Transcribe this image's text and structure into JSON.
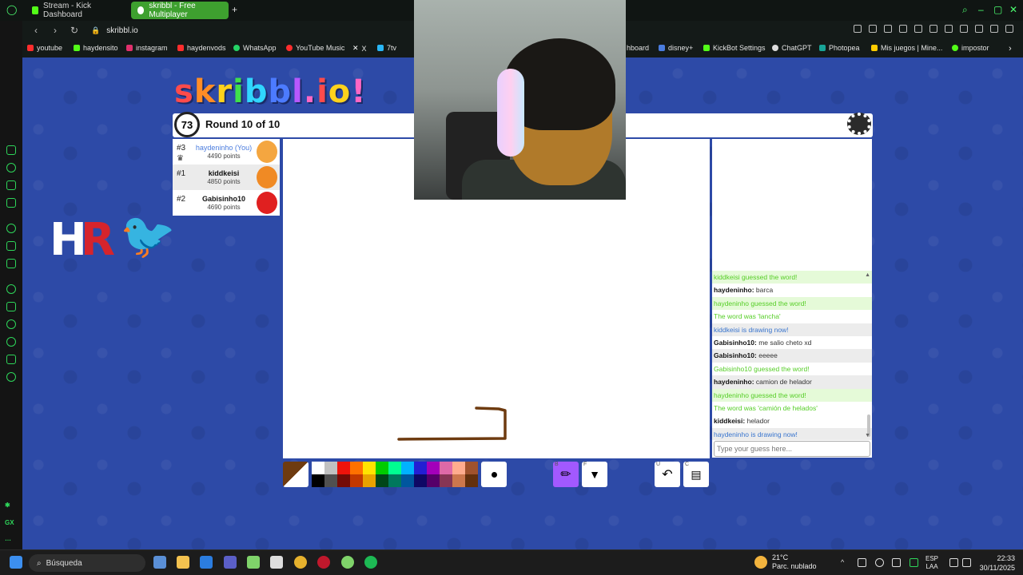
{
  "browser": {
    "tabs": [
      {
        "label": "Stream - Kick Dashboard",
        "color": "#53fc18"
      },
      {
        "label": "skribbl - Free Multiplayer",
        "color": "#ffffff"
      }
    ],
    "new_tab": "+",
    "url": "skribbl.io",
    "bookmarks": [
      {
        "label": "youtube",
        "color": "#ff2d2d"
      },
      {
        "label": "haydensito",
        "color": "#53fc18"
      },
      {
        "label": "instagram",
        "color": "#e1306c"
      },
      {
        "label": "haydenvods",
        "color": "#ff2d2d"
      },
      {
        "label": "WhatsApp",
        "color": "#25d366"
      },
      {
        "label": "YouTube Music",
        "color": "#ff2d2d"
      },
      {
        "label": "X",
        "color": "#ffffff"
      },
      {
        "label": "7tv",
        "color": "#29b6f6"
      },
      {
        "label": "hboard",
        "color": "#888888"
      },
      {
        "label": "disney+",
        "color": "#4a7cde"
      },
      {
        "label": "KickBot Settings",
        "color": "#53fc18"
      },
      {
        "label": "ChatGPT",
        "color": "#dddddd"
      },
      {
        "label": "Photopea",
        "color": "#18a497"
      },
      {
        "label": "Mis juegos | Mine...",
        "color": "#ffcc00"
      },
      {
        "label": "impostor",
        "color": "#53fc18"
      }
    ],
    "sidebar_labels": [
      "GX"
    ]
  },
  "game": {
    "logo": "skribbl.io",
    "timer": "73",
    "round": "Round 10 of 10",
    "players": [
      {
        "rank": "#3",
        "name": "haydeninho (You)",
        "points": "4490 points",
        "avatar_color": "#f4a640"
      },
      {
        "rank": "#1",
        "name": "kiddkeisi",
        "points": "4850 points",
        "avatar_color": "#f08a24"
      },
      {
        "rank": "#2",
        "name": "Gabisinho10",
        "points": "4690 points",
        "avatar_color": "#e02020"
      }
    ],
    "chat": [
      {
        "type": "greenbg",
        "text": "kiddkeisi guessed the word!"
      },
      {
        "type": "msg",
        "user": "haydeninho:",
        "text": "barca"
      },
      {
        "type": "greenbg",
        "text": "haydeninho guessed the word!"
      },
      {
        "type": "green",
        "text": "The word was 'lancha'"
      },
      {
        "type": "blue",
        "text": "kiddkeisi is drawing now!"
      },
      {
        "type": "msg",
        "user": "Gabisinho10:",
        "text": "me salio cheto xd"
      },
      {
        "type": "msgalt",
        "user": "Gabisinho10:",
        "text": "eeeee"
      },
      {
        "type": "green",
        "text": "Gabisinho10 guessed the word!"
      },
      {
        "type": "msg",
        "user": "haydeninho:",
        "text": "camion de helador"
      },
      {
        "type": "greenbg",
        "text": "haydeninho guessed the word!"
      },
      {
        "type": "green",
        "text": "The word was 'camión de helados'"
      },
      {
        "type": "msg",
        "user": "kiddkeisi:",
        "text": "helador"
      },
      {
        "type": "blue",
        "text": "haydeninho is drawing now!"
      }
    ],
    "guess_placeholder": "Type your guess here...",
    "current_color": "#6e3b10",
    "palette_top": [
      "#ffffff",
      "#c1c1c1",
      "#ef130b",
      "#ff7100",
      "#ffe400",
      "#00cc00",
      "#00ff91",
      "#00b2ff",
      "#231fd3",
      "#a300ba",
      "#df69a7",
      "#ffac8e",
      "#a0522d"
    ],
    "palette_bottom": [
      "#000000",
      "#505050",
      "#740b07",
      "#c23800",
      "#e8a200",
      "#004619",
      "#00785d",
      "#00569e",
      "#0e0865",
      "#550069",
      "#873554",
      "#cc774d",
      "#63300d"
    ],
    "tools": [
      {
        "key": "B",
        "name": "pencil",
        "glyph": "✏"
      },
      {
        "key": "F",
        "name": "fill",
        "glyph": "🪣"
      },
      {
        "key": "U",
        "name": "undo",
        "glyph": "↶"
      },
      {
        "key": "C",
        "name": "clear",
        "glyph": "🗑"
      }
    ]
  },
  "taskbar": {
    "search": "Búsqueda",
    "weather_temp": "21°C",
    "weather_desc": "Parc. nublado",
    "lang_1": "ESP",
    "lang_2": "LAA",
    "time": "22:33",
    "date": "30/11/2025"
  }
}
